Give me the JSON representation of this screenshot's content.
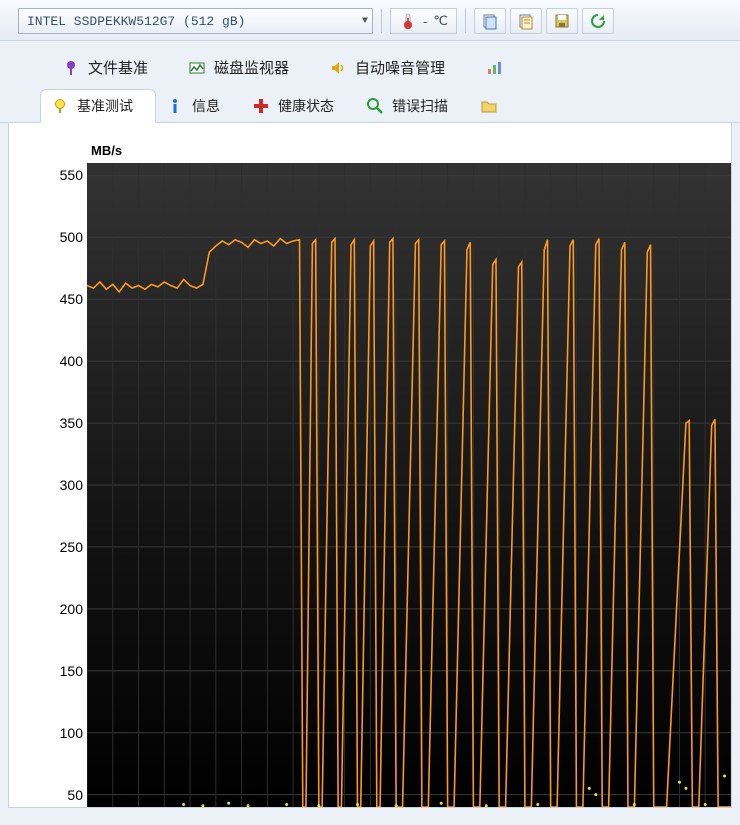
{
  "drive": {
    "label": "INTEL SSDPEKKW512G7 (512 gB)"
  },
  "temperature": {
    "value": "-",
    "unit": "℃"
  },
  "tabs_upper": [
    {
      "key": "file_benchmark",
      "label": "文件基准",
      "iconColor": "#8c3cc7"
    },
    {
      "key": "disk_monitor",
      "label": "磁盘监视器",
      "iconColor": "#2b7b36"
    },
    {
      "key": "noise_mgmt",
      "label": "自动噪音管理",
      "iconColor": "#e0a800"
    }
  ],
  "tabs_lower": [
    {
      "key": "benchmark",
      "label": "基准测试",
      "active": true,
      "iconColor": "#e6c200"
    },
    {
      "key": "info",
      "label": "信息",
      "iconColor": "#1c6fd6"
    },
    {
      "key": "health",
      "label": "健康状态",
      "iconColor": "#cc2b2b"
    },
    {
      "key": "errorscan",
      "label": "错误扫描",
      "iconColor": "#2a9d3a"
    }
  ],
  "chart_data": {
    "type": "line",
    "title": "",
    "xlabel": "",
    "ylabel": "MB/s",
    "ylim": [
      40,
      560
    ],
    "y_ticks": [
      50,
      100,
      150,
      200,
      250,
      300,
      350,
      400,
      450,
      500,
      550
    ],
    "x_range": [
      0,
      100
    ],
    "series": [
      {
        "name": "read_speed",
        "color": "#ff9a1f",
        "data": [
          [
            0,
            461
          ],
          [
            1,
            459
          ],
          [
            2,
            464
          ],
          [
            3,
            458
          ],
          [
            4,
            462
          ],
          [
            5,
            456
          ],
          [
            6,
            463
          ],
          [
            7,
            459
          ],
          [
            8,
            461
          ],
          [
            9,
            458
          ],
          [
            10,
            462
          ],
          [
            11,
            460
          ],
          [
            12,
            464
          ],
          [
            13,
            461
          ],
          [
            14,
            459
          ],
          [
            15,
            466
          ],
          [
            16,
            461
          ],
          [
            17,
            459
          ],
          [
            18,
            462
          ],
          [
            19,
            488
          ],
          [
            20,
            493
          ],
          [
            21,
            497
          ],
          [
            22,
            494
          ],
          [
            23,
            498
          ],
          [
            24,
            496
          ],
          [
            25,
            492
          ],
          [
            26,
            498
          ],
          [
            27,
            495
          ],
          [
            28,
            497
          ],
          [
            29,
            493
          ],
          [
            30,
            499
          ],
          [
            31,
            495
          ],
          [
            32,
            497
          ],
          [
            33,
            498
          ],
          [
            33.5,
            40
          ],
          [
            34,
            40
          ],
          [
            35,
            495
          ],
          [
            35.5,
            498
          ],
          [
            36,
            40
          ],
          [
            36.5,
            40
          ],
          [
            38,
            496
          ],
          [
            38.5,
            499
          ],
          [
            39,
            40
          ],
          [
            39.5,
            40
          ],
          [
            41,
            494
          ],
          [
            41.5,
            498
          ],
          [
            42,
            40
          ],
          [
            42.5,
            40
          ],
          [
            44,
            493
          ],
          [
            44.5,
            497
          ],
          [
            45,
            40
          ],
          [
            45.5,
            40
          ],
          [
            47,
            496
          ],
          [
            47.5,
            499
          ],
          [
            48,
            40
          ],
          [
            49,
            40
          ],
          [
            51,
            495
          ],
          [
            51.5,
            498
          ],
          [
            52,
            40
          ],
          [
            53,
            40
          ],
          [
            55,
            494
          ],
          [
            55.5,
            497
          ],
          [
            56,
            40
          ],
          [
            57,
            40
          ],
          [
            59,
            490
          ],
          [
            59.5,
            496
          ],
          [
            60,
            40
          ],
          [
            61,
            40
          ],
          [
            63,
            478
          ],
          [
            63.5,
            482
          ],
          [
            64,
            40
          ],
          [
            65,
            40
          ],
          [
            67,
            476
          ],
          [
            67.5,
            480
          ],
          [
            68,
            40
          ],
          [
            69,
            40
          ],
          [
            71,
            490
          ],
          [
            71.5,
            498
          ],
          [
            72,
            40
          ],
          [
            73,
            40
          ],
          [
            75,
            493
          ],
          [
            75.5,
            498
          ],
          [
            76,
            40
          ],
          [
            77,
            40
          ],
          [
            79,
            494
          ],
          [
            79.5,
            499
          ],
          [
            80,
            40
          ],
          [
            81,
            40
          ],
          [
            83,
            490
          ],
          [
            83.5,
            496
          ],
          [
            84,
            40
          ],
          [
            85,
            40
          ],
          [
            87,
            488
          ],
          [
            87.5,
            494
          ],
          [
            88,
            40
          ],
          [
            90,
            40
          ],
          [
            93,
            350
          ],
          [
            93.5,
            352
          ],
          [
            94,
            40
          ],
          [
            95,
            40
          ],
          [
            97,
            348
          ],
          [
            97.5,
            353
          ],
          [
            98,
            40
          ],
          [
            100,
            40
          ]
        ]
      },
      {
        "name": "access_time",
        "color": "#e6e62a",
        "data": [
          [
            15,
            42
          ],
          [
            18,
            41
          ],
          [
            22,
            43
          ],
          [
            25,
            41
          ],
          [
            31,
            42
          ],
          [
            36,
            41
          ],
          [
            42,
            42
          ],
          [
            48,
            41
          ],
          [
            55,
            43
          ],
          [
            62,
            41
          ],
          [
            70,
            42
          ],
          [
            78,
            55
          ],
          [
            79,
            50
          ],
          [
            85,
            42
          ],
          [
            92,
            60
          ],
          [
            93,
            55
          ],
          [
            96,
            42
          ],
          [
            99,
            65
          ]
        ]
      }
    ]
  }
}
